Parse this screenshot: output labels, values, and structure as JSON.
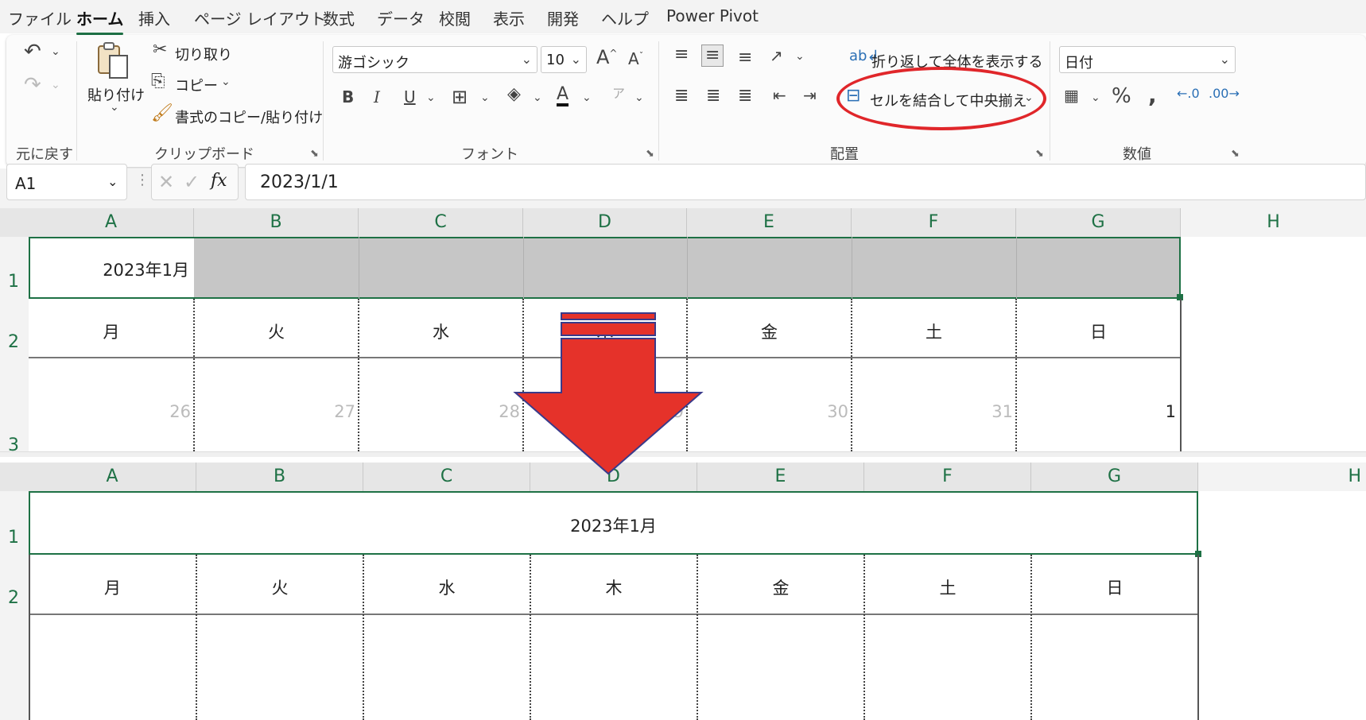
{
  "menu": {
    "tabs": [
      "ファイル",
      "ホーム",
      "挿入",
      "ページ レイアウト",
      "数式",
      "データ",
      "校閲",
      "表示",
      "開発",
      "ヘルプ",
      "Power Pivot"
    ],
    "active_tab": "ホーム"
  },
  "ribbon": {
    "undo_group": {
      "label": "元に戻す"
    },
    "clipboard": {
      "label": "クリップボード",
      "paste": "貼り付け",
      "cut": "切り取り",
      "copy": "コピー",
      "format_painter": "書式のコピー/貼り付け"
    },
    "font": {
      "label": "フォント",
      "font_name": "游ゴシック",
      "font_size": "10",
      "bold": "B",
      "italic": "I",
      "underline": "U"
    },
    "alignment": {
      "label": "配置",
      "wrap_text": "折り返して全体を表示する",
      "merge_center": "セルを結合して中央揃え"
    },
    "number": {
      "label": "数値",
      "format": "日付"
    }
  },
  "formula_bar": {
    "name_box": "A1",
    "fx": "fx",
    "value": "2023/1/1"
  },
  "columns": [
    "A",
    "B",
    "C",
    "D",
    "E",
    "F",
    "G",
    "H"
  ],
  "before": {
    "row1": "2023年1月",
    "weekdays": [
      "月",
      "火",
      "水",
      "木",
      "金",
      "土",
      "日"
    ],
    "dates": [
      "26",
      "27",
      "28",
      "29",
      "30",
      "31",
      "1"
    ]
  },
  "after": {
    "row1": "2023年1月",
    "weekdays": [
      "月",
      "火",
      "水",
      "木",
      "金",
      "土",
      "日"
    ]
  },
  "row_numbers": [
    "1",
    "2",
    "3"
  ],
  "colors": {
    "accent": "#1e7145",
    "highlight_oval": "#e0262a",
    "arrow": "#e5322a",
    "selection_fill": "#c6c6c6"
  }
}
